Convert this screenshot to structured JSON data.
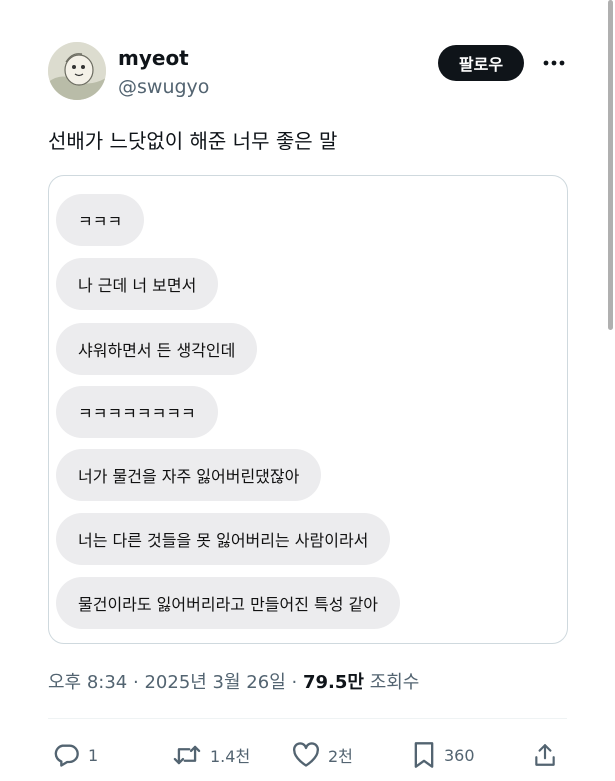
{
  "author": {
    "name": "myeot",
    "handle": "@swugyo"
  },
  "follow_button_label": "팔로우",
  "post_text": "선배가 느닷없이 해준 너무 좋은 말",
  "chat_messages": [
    "ㅋㅋㅋ",
    "나 근데 너 보면서",
    "샤워하면서 든 생각인데",
    "ㅋㅋㅋㅋㅋㅋㅋㅋ",
    "너가 물건을 자주 잃어버린댔잖아",
    "너는 다른 것들을 못 잃어버리는 사람이라서",
    "물건이라도 잃어버리라고 만들어진 특성 같아"
  ],
  "meta": {
    "time": "오후 8:34",
    "date": "2025년 3월 26일",
    "separator": "·",
    "views_count": "79.5만",
    "views_label": "조회수"
  },
  "actions": {
    "replies": "1",
    "reposts": "1.4천",
    "likes": "2천",
    "bookmarks": "360"
  },
  "colors": {
    "text_primary": "#0f1419",
    "text_secondary": "#536471",
    "bubble_bg": "#ececee",
    "follow_bg": "#0f1419",
    "card_border": "#cfd9de"
  },
  "icons": [
    "more-icon",
    "reply-icon",
    "repost-icon",
    "like-icon",
    "bookmark-icon",
    "share-icon"
  ]
}
